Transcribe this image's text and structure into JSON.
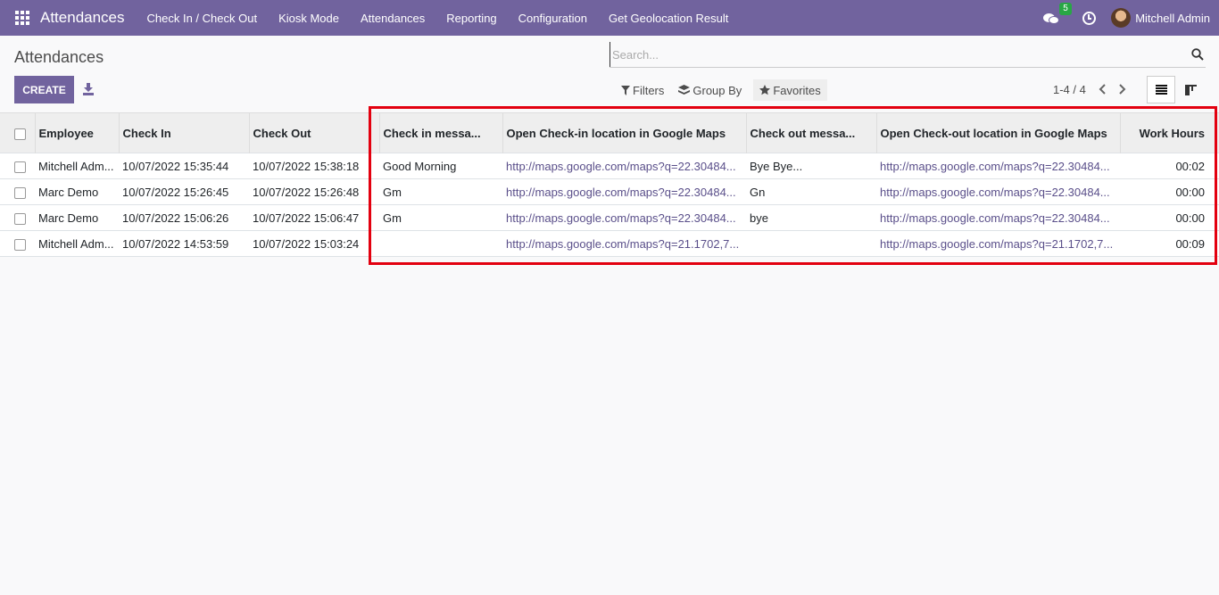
{
  "navbar": {
    "brand": "Attendances",
    "menu": [
      "Check In / Check Out",
      "Kiosk Mode",
      "Attendances",
      "Reporting",
      "Configuration",
      "Get Geolocation Result"
    ],
    "chat_badge": "5",
    "user_name": "Mitchell Admin"
  },
  "control": {
    "title": "Attendances",
    "create_label": "CREATE",
    "search_placeholder": "Search...",
    "filters_label": "Filters",
    "groupby_label": "Group By",
    "favorites_label": "Favorites",
    "pager": "1-4 / 4"
  },
  "table": {
    "columns": [
      "Employee",
      "Check In",
      "Check Out",
      "Check in messa...",
      "Open Check-in location in Google Maps",
      "Check out messa...",
      "Open Check-out location in Google Maps",
      "Work Hours"
    ],
    "rows": [
      [
        "Mitchell Adm...",
        "10/07/2022 15:35:44",
        "10/07/2022 15:38:18",
        "Good Morning",
        "http://maps.google.com/maps?q=22.30484...",
        "Bye Bye...",
        "http://maps.google.com/maps?q=22.30484...",
        "00:02"
      ],
      [
        "Marc Demo",
        "10/07/2022 15:26:45",
        "10/07/2022 15:26:48",
        "Gm",
        "http://maps.google.com/maps?q=22.30484...",
        "Gn",
        "http://maps.google.com/maps?q=22.30484...",
        "00:00"
      ],
      [
        "Marc Demo",
        "10/07/2022 15:06:26",
        "10/07/2022 15:06:47",
        "Gm",
        "http://maps.google.com/maps?q=22.30484...",
        "bye",
        "http://maps.google.com/maps?q=22.30484...",
        "00:00"
      ],
      [
        "Mitchell Adm...",
        "10/07/2022 14:53:59",
        "10/07/2022 15:03:24",
        "",
        "http://maps.google.com/maps?q=21.1702,7...",
        "",
        "http://maps.google.com/maps?q=21.1702,7...",
        "00:09"
      ]
    ]
  },
  "colors": {
    "navbar": "#71639e",
    "highlight": "#e3000f",
    "badge": "#28a745"
  }
}
